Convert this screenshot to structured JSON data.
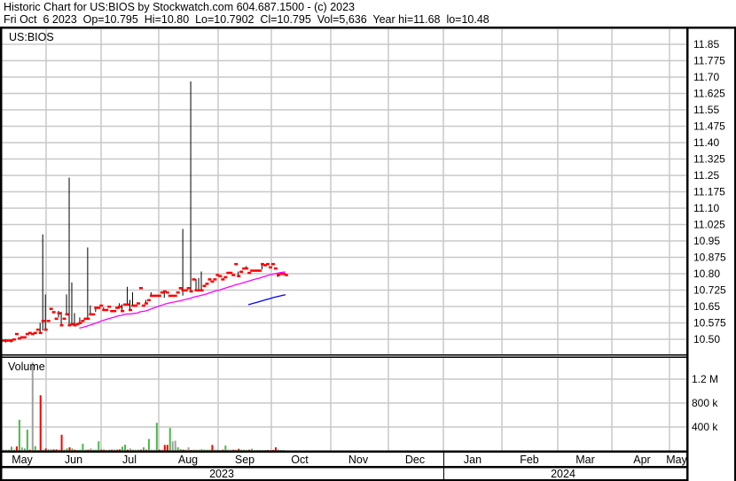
{
  "header": {
    "title": "Historic Chart for US:BIOS by Stockwatch.com 604.687.1500 - (c) 2023",
    "quote": "Fri Oct  6 2023  Op=10.795  Hi=10.80  Lo=10.7902  Cl=10.795  Vol=5,636  Year hi=11.68  lo=10.48"
  },
  "chart_data": [
    {
      "type": "bar",
      "title": "US:BIOS",
      "ylim": [
        10.46,
        11.9
      ],
      "yticks": [
        "11.85",
        "11.775",
        "11.70",
        "11.625",
        "11.55",
        "11.475",
        "11.40",
        "11.325",
        "11.25",
        "11.175",
        "11.10",
        "11.025",
        "10.95",
        "10.875",
        "10.80",
        "10.725",
        "10.65",
        "10.575",
        "10.50"
      ],
      "grid": true,
      "close": [
        10.495,
        10.495,
        10.495,
        10.495,
        10.5,
        10.525,
        10.505,
        10.51,
        10.51,
        10.525,
        10.53,
        10.525,
        10.53,
        10.545,
        10.53,
        10.585,
        10.545,
        10.585,
        10.64,
        10.625,
        10.595,
        10.62,
        10.565,
        10.595,
        10.615,
        10.565,
        10.57,
        10.565,
        10.57,
        10.575,
        10.585,
        10.595,
        10.595,
        10.615,
        10.615,
        10.645,
        10.645,
        10.655,
        10.635,
        10.635,
        10.65,
        10.63,
        10.63,
        10.645,
        10.65,
        10.63,
        10.66,
        10.66,
        10.635,
        10.655,
        10.655,
        10.665,
        10.735,
        10.655,
        10.665,
        10.68,
        10.7,
        10.7,
        10.7,
        10.7,
        10.715,
        10.72,
        10.715,
        10.7,
        10.7,
        10.7,
        10.715,
        10.735,
        10.725,
        10.725,
        10.735,
        10.72,
        10.775,
        10.725,
        10.725,
        10.725,
        10.745,
        10.755,
        10.775,
        10.765,
        10.775,
        10.795,
        10.79,
        10.775,
        10.785,
        10.805,
        10.805,
        10.795,
        10.845,
        10.79,
        10.81,
        10.825,
        10.825,
        10.805,
        10.815,
        10.815,
        10.815,
        10.815,
        10.845,
        10.84,
        10.845,
        10.83,
        10.845,
        10.825,
        10.795,
        10.8,
        10.8,
        10.795
      ],
      "ranges": [
        [
          1,
          10.5,
          10.485
        ],
        [
          3,
          10.5,
          10.485
        ],
        [
          14,
          10.575,
          10.53
        ],
        [
          15,
          10.98,
          10.54
        ],
        [
          16,
          10.705,
          10.545
        ],
        [
          21,
          10.63,
          10.6
        ],
        [
          22,
          10.625,
          10.565
        ],
        [
          24,
          10.705,
          10.61
        ],
        [
          25,
          11.24,
          10.565
        ],
        [
          26,
          10.76,
          10.565
        ],
        [
          27,
          10.62,
          10.565
        ],
        [
          29,
          10.6,
          10.575
        ],
        [
          32,
          10.92,
          10.595
        ],
        [
          33,
          10.655,
          10.615
        ],
        [
          35,
          10.65,
          10.625
        ],
        [
          38,
          10.645,
          10.63
        ],
        [
          44,
          10.665,
          10.64
        ],
        [
          45,
          10.66,
          10.625
        ],
        [
          47,
          10.74,
          10.66
        ],
        [
          48,
          10.68,
          10.635
        ],
        [
          49,
          10.715,
          10.655
        ],
        [
          54,
          10.68,
          10.665
        ],
        [
          56,
          10.715,
          10.7
        ],
        [
          61,
          10.72,
          10.69
        ],
        [
          68,
          11.005,
          10.7
        ],
        [
          71,
          11.68,
          10.72
        ],
        [
          73,
          10.775,
          10.725
        ],
        [
          74,
          10.78,
          10.725
        ],
        [
          75,
          10.81,
          10.725
        ],
        [
          89,
          10.81,
          10.79
        ],
        [
          92,
          10.835,
          10.825
        ],
        [
          98,
          10.845,
          10.82
        ],
        [
          104,
          10.8,
          10.785
        ]
      ],
      "colors": {
        "close": "#ff0000",
        "range": "#000000",
        "ma_short": "#ff00ff",
        "ma_long": "#0000ff",
        "grid": "#c8c8c8"
      }
    },
    {
      "type": "bar",
      "title": "Volume",
      "ylim": [
        0,
        1600000
      ],
      "yticks": [
        "1.2 M",
        "800 k",
        "400 k"
      ],
      "ytick_values": [
        1200000,
        800000,
        400000
      ],
      "values_k": [
        20,
        20,
        20,
        70,
        20,
        75,
        520,
        60,
        40,
        355,
        20,
        1480,
        80,
        15,
        930,
        20,
        40,
        25,
        25,
        25,
        25,
        20,
        270,
        20,
        40,
        60,
        40,
        20,
        15,
        20,
        120,
        20,
        20,
        40,
        20,
        20,
        160,
        20,
        20,
        15,
        20,
        20,
        20,
        20,
        25,
        70,
        105,
        20,
        40,
        20,
        20,
        20,
        20,
        60,
        20,
        200,
        20,
        20,
        470,
        20,
        20,
        100,
        100,
        385,
        160,
        170,
        60,
        30,
        20,
        20,
        60,
        15,
        20,
        20,
        20,
        30,
        20,
        20,
        20,
        100,
        20,
        20,
        15,
        20,
        90,
        20,
        20,
        20,
        20,
        35,
        20,
        20,
        20,
        20,
        35,
        15,
        15,
        15,
        15,
        15,
        15,
        15,
        15,
        60,
        20,
        15,
        15,
        6
      ],
      "direction": "kkkgkrgkggrkgkrgrggrrgrggrgrggsgrkggsrrggrgrrggrkgkgrgrgkkgrkrrgkkggrgkrgkgkgggrggkrggkrgrggkrgkkgkkrkrrgkkk",
      "colors": {
        "g": "#4cb848",
        "r": "#ff0000",
        "k": "#a0a0a0",
        "s": "#4cb848"
      }
    }
  ],
  "axis": {
    "months": [
      "May",
      "Jun",
      "Jul",
      "Aug",
      "Sep",
      "Oct",
      "Nov",
      "Dec",
      "Jan",
      "Feb",
      "Mar",
      "Apr",
      "May"
    ],
    "years": [
      "2023",
      "2024"
    ]
  }
}
